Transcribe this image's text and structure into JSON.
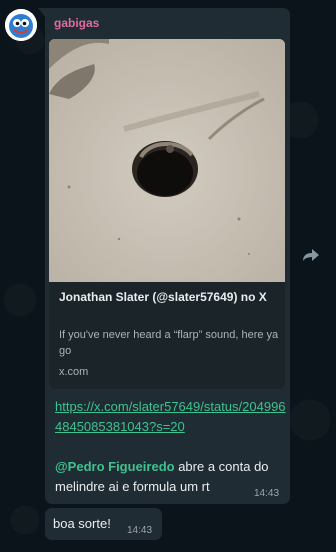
{
  "message": {
    "sender": "gabigas",
    "link_preview": {
      "title": "Jonathan Slater (@slater57649) no X",
      "description": "If you've never heard a “flarp” sound, here ya go",
      "domain": "x.com"
    },
    "link_url": "https://x.com/slater57649/status/2049964845085381043?s=20",
    "mention": "@Pedro Figueiredo",
    "text_after_mention": " abre a conta do melindre ai e formula um rt",
    "time": "14:43"
  },
  "message2": {
    "text": "boa sorte!",
    "time": "14:43"
  },
  "icons": {
    "forward": "forward-icon",
    "avatar": "avatar-image"
  },
  "colors": {
    "background": "#0b141a",
    "bubble": "#202c33",
    "sender_name": "#e06c9f",
    "link": "#3ec28f",
    "text": "#e9edef",
    "meta": "#9ba5aa"
  }
}
